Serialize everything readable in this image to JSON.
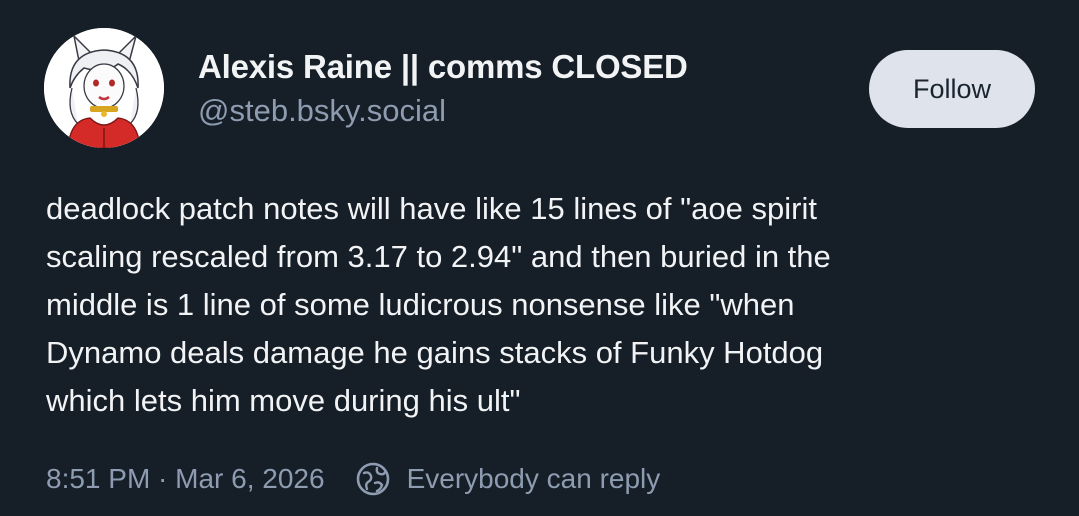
{
  "author": {
    "display_name": "Alexis Raine || comms CLOSED",
    "handle": "@steb.bsky.social",
    "avatar_icon": "avatar-illustration"
  },
  "follow_label": "Follow",
  "post": {
    "lines": [
      "deadlock patch notes will have like 15 lines of \"aoe spirit",
      "scaling rescaled from 3.17 to 2.94\" and then buried in the",
      "middle is 1 line of some ludicrous nonsense like \"when",
      "Dynamo deals damage he gains stacks of Funky Hotdog",
      "which lets him move during his ult\""
    ],
    "timestamp": "8:51 PM · Mar 6, 2026",
    "reply_setting": "Everybody can reply",
    "reply_icon": "globe-chat-icon"
  },
  "colors": {
    "background": "#161e27",
    "text": "#f1f3f5",
    "muted": "#8d9cb0",
    "button_bg": "#dfe4ec"
  }
}
